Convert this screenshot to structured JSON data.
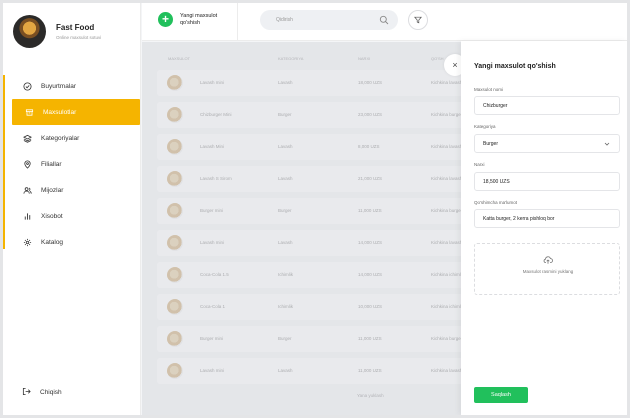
{
  "brand": {
    "title": "Fast Food",
    "subtitle": "Online maxsulot sotuvi"
  },
  "sidebar": {
    "items": [
      {
        "label": "Buyurtmalar",
        "icon": "check-circle-icon"
      },
      {
        "label": "Maxsulotlar",
        "icon": "box-icon",
        "active": true
      },
      {
        "label": "Kategoriyalar",
        "icon": "layers-icon"
      },
      {
        "label": "Filiallar",
        "icon": "location-pin-icon"
      },
      {
        "label": "Mijozlar",
        "icon": "users-icon"
      },
      {
        "label": "Xisobot",
        "icon": "bar-chart-icon"
      },
      {
        "label": "Katalog",
        "icon": "gear-icon"
      }
    ],
    "logout_label": "Chiqish"
  },
  "topbar": {
    "add_label": "Yangi maxsulot qo'shish",
    "search_placeholder": "Qidirish"
  },
  "table": {
    "headers": [
      "MAXSULOT",
      "KATEGORIYA",
      "NARXI",
      "QO'SH"
    ],
    "rows": [
      [
        "Lavash mini",
        "Lavash",
        "18,000 UZS",
        "Kichkina lavash"
      ],
      [
        "Chizburger Mini",
        "Burger",
        "23,000 UZS",
        "Kichkina burger"
      ],
      [
        "Lavash Mini",
        "Lavash",
        "8,000 UZS",
        "Kichkina lavash"
      ],
      [
        "Lavash S Sirom",
        "Lavash",
        "21,000 UZS",
        "Kichkina lavash"
      ],
      [
        "Burger mini",
        "Burger",
        "11,000 UZS",
        "Kichkina burger"
      ],
      [
        "Lavash mini",
        "Lavash",
        "14,000 UZS",
        "Kichkina lavash"
      ],
      [
        "Coca-Cola 1.5",
        "Ichimlik",
        "14,000 UZS",
        "Kichkina ichimlik"
      ],
      [
        "Coca-Cola 1",
        "Ichimlik",
        "10,000 UZS",
        "Kichkina ichimlik"
      ],
      [
        "Burger mini",
        "Burger",
        "11,000 UZS",
        "Kichkina burger"
      ],
      [
        "Lavash mini",
        "Lavash",
        "11,000 UZS",
        "Kichkina lavash"
      ]
    ],
    "more_label": "Yana yuklash"
  },
  "panel": {
    "title": "Yangi maxsulot qo'shish",
    "name_label": "Maxsulot nomi",
    "name_value": "Chizburger",
    "category_label": "Kategoriya",
    "category_value": "Burger",
    "price_label": "Narxi",
    "price_value": "18,500 UZS",
    "info_label": "Qo'shimcha ma'lumot",
    "info_value": "Katta burger, 2 kerra pishloq bor",
    "upload_label": "Maxsulot rasmini yuklang",
    "save_label": "Saqlash",
    "close_glyph": "×"
  },
  "colors": {
    "accent": "#f5b400",
    "success": "#21c05c"
  }
}
